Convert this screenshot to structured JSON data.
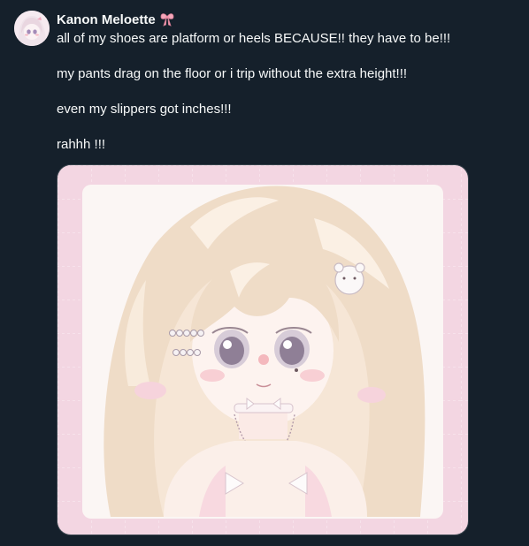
{
  "tweet": {
    "author": {
      "display_name": "Kanon Meloette",
      "name_emoji": "pink-ribbon-emoji",
      "avatar": "anime-girl-avatar"
    },
    "lines": [
      "all of my shoes are platform or heels BECAUSE!! they have to be!!!",
      "my pants drag on the floor or i trip without the extra height!!!",
      "even my slippers got inches!!!",
      "rahhh !!!"
    ],
    "media": {
      "kind": "illustration",
      "subject": "pastel anime girl with long blonde wavy hair, hair clips, choker with key pendant, pink frame"
    }
  },
  "colors": {
    "background": "#15202b",
    "text": "#f7f9f9",
    "frame_pink": "#f3d6e2",
    "hair": "#eedcc4"
  }
}
